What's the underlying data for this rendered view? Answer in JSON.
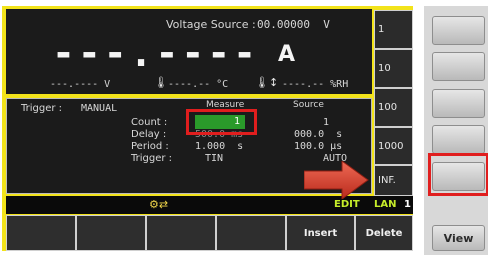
{
  "voltage_source": {
    "label": "Voltage Source :",
    "value": "00.00000  V"
  },
  "main_reading": {
    "value": "---.----",
    "unit": "A"
  },
  "secondary": {
    "voltage": "---.---- V",
    "temp": "----.-- °C",
    "humidity": "----.-- %RH"
  },
  "trigger": {
    "label": "Trigger :",
    "value": "MANUAL"
  },
  "columns": {
    "measure": "Measure",
    "source": "Source"
  },
  "params": {
    "count_label": "Count :",
    "count_measure": "1",
    "count_source": "1",
    "delay_label": "Delay :",
    "delay_measure": "500.0 ms",
    "delay_source": "000.0  s",
    "period_label": "Period :",
    "period_measure": "1.000  s",
    "period_source": "100.0 µs",
    "trigger_label": "Trigger :",
    "trigger_measure": "TIN",
    "trigger_source": "AUTO"
  },
  "side_options": [
    "1",
    "10",
    "100",
    "1000",
    "INF."
  ],
  "status": {
    "mode": "EDIT",
    "lan": "LAN",
    "lan_num": "1"
  },
  "softkeys": [
    "",
    "",
    "",
    "",
    "Insert",
    "Delete"
  ],
  "hardware": {
    "view_label": "View"
  },
  "colors": {
    "bezel": "#f2e31a",
    "screen": "#1b1b1b",
    "edit_green": "#2a9a2a",
    "highlight_red": "#e01e1e",
    "arrow": "#d83a2a"
  }
}
